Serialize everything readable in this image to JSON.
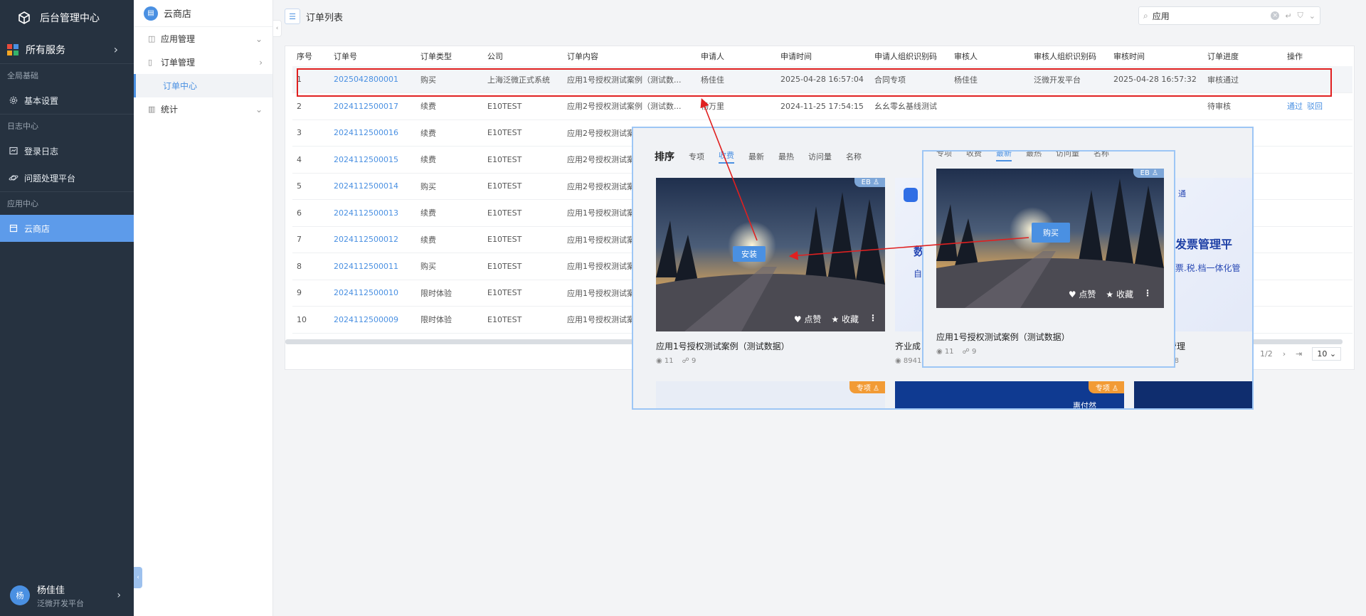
{
  "sidebar": {
    "app_title": "后台管理中心",
    "all_services": "所有服务",
    "groups": [
      {
        "label": "全局基础",
        "items": [
          {
            "label": "基本设置",
            "icon": "gear-icon"
          }
        ]
      },
      {
        "label": "日志中心",
        "items": [
          {
            "label": "登录日志",
            "icon": "log-icon"
          },
          {
            "label": "问题处理平台",
            "icon": "planet-icon"
          }
        ]
      },
      {
        "label": "应用中心",
        "items": [
          {
            "label": "云商店",
            "icon": "store-icon"
          }
        ]
      }
    ],
    "user": {
      "avatar": "杨",
      "name": "杨佳佳",
      "org": "泛微开发平台"
    }
  },
  "subnav": {
    "title": "云商店",
    "items": [
      {
        "label": "应用管理"
      },
      {
        "label": "订单管理"
      },
      {
        "label": "订单中心"
      },
      {
        "label": "统计"
      }
    ]
  },
  "header": {
    "title": "订单列表"
  },
  "search": {
    "value": "应用"
  },
  "table": {
    "columns": [
      "序号",
      "订单号",
      "订单类型",
      "公司",
      "订单内容",
      "申请人",
      "申请时间",
      "申请人组织识别码",
      "审核人",
      "审核人组织识别码",
      "审核时间",
      "订单进度",
      "操作"
    ],
    "rows": [
      [
        "1",
        "2025042800001",
        "购买",
        "上海泛微正式系统",
        "应用1号授权测试案例（测试数...",
        "杨佳佳",
        "2025-04-28 16:57:04",
        "合同专项",
        "杨佳佳",
        "泛微开发平台",
        "2025-04-28 16:57:32",
        "审核通过",
        ""
      ],
      [
        "2",
        "2024112500017",
        "续费",
        "E10TEST",
        "应用2号授权测试案例（测试数...",
        "杨万里",
        "2024-11-25 17:54:15",
        "幺幺零幺基线测试",
        "",
        "",
        "",
        "待审核",
        ""
      ],
      [
        "3",
        "2024112500016",
        "续费",
        "E10TEST",
        "应用2号授权测试案",
        "",
        "",
        "",
        "",
        "",
        "",
        "",
        ""
      ],
      [
        "4",
        "2024112500015",
        "续费",
        "E10TEST",
        "应用2号授权测试案",
        "",
        "",
        "",
        "",
        "",
        "",
        "",
        ""
      ],
      [
        "5",
        "2024112500014",
        "购买",
        "E10TEST",
        "应用2号授权测试案",
        "",
        "",
        "",
        "",
        "",
        "",
        "",
        ""
      ],
      [
        "6",
        "2024112500013",
        "续费",
        "E10TEST",
        "应用1号授权测试案",
        "",
        "",
        "",
        "",
        "",
        "",
        "",
        ""
      ],
      [
        "7",
        "2024112500012",
        "续费",
        "E10TEST",
        "应用1号授权测试案",
        "",
        "",
        "",
        "",
        "",
        "",
        "",
        ""
      ],
      [
        "8",
        "2024112500011",
        "购买",
        "E10TEST",
        "应用1号授权测试案",
        "",
        "",
        "",
        "",
        "",
        "",
        "",
        ""
      ],
      [
        "9",
        "2024112500010",
        "限时体验",
        "E10TEST",
        "应用1号授权测试案",
        "",
        "",
        "",
        "",
        "",
        "",
        "",
        ""
      ],
      [
        "10",
        "2024112500009",
        "限时体验",
        "E10TEST",
        "应用1号授权测试案",
        "",
        "",
        "",
        "",
        "",
        "",
        "",
        ""
      ]
    ],
    "row2_actions": [
      "通过",
      "驳回"
    ]
  },
  "pager": {
    "page": "1/2",
    "size": "10"
  },
  "popup": {
    "sort_label": "排序",
    "tabs": [
      "专项",
      "收费",
      "最新",
      "最热",
      "访问量",
      "名称"
    ],
    "active_tab": "收费",
    "card1": {
      "badge": "EB",
      "install": "安装",
      "like": "点赞",
      "fav": "收藏",
      "title": "应用1号授权测试案例（测试数据）",
      "views": "11",
      "uses": "9"
    },
    "card2": {
      "text1": "数",
      "text2": "自",
      "title": "齐业成",
      "views": "8941"
    },
    "card3": {
      "heading": "化发票管理平",
      "sub": "财.票.税.档一体化管",
      "tag": "通",
      "title": "管理",
      "views": "458"
    },
    "row2_badges": [
      "专项",
      "专项"
    ],
    "row2_text": "惠付然"
  },
  "popup2": {
    "badge": "EB",
    "buy": "购买",
    "like": "点赞",
    "fav": "收藏",
    "title": "应用1号授权测试案例（测试数据）",
    "views": "11",
    "uses": "9"
  },
  "colors": {
    "sidebar_bg": "#263240",
    "accent": "#4a90e2",
    "active": "#5d9bea",
    "highlight": "#e02020"
  }
}
